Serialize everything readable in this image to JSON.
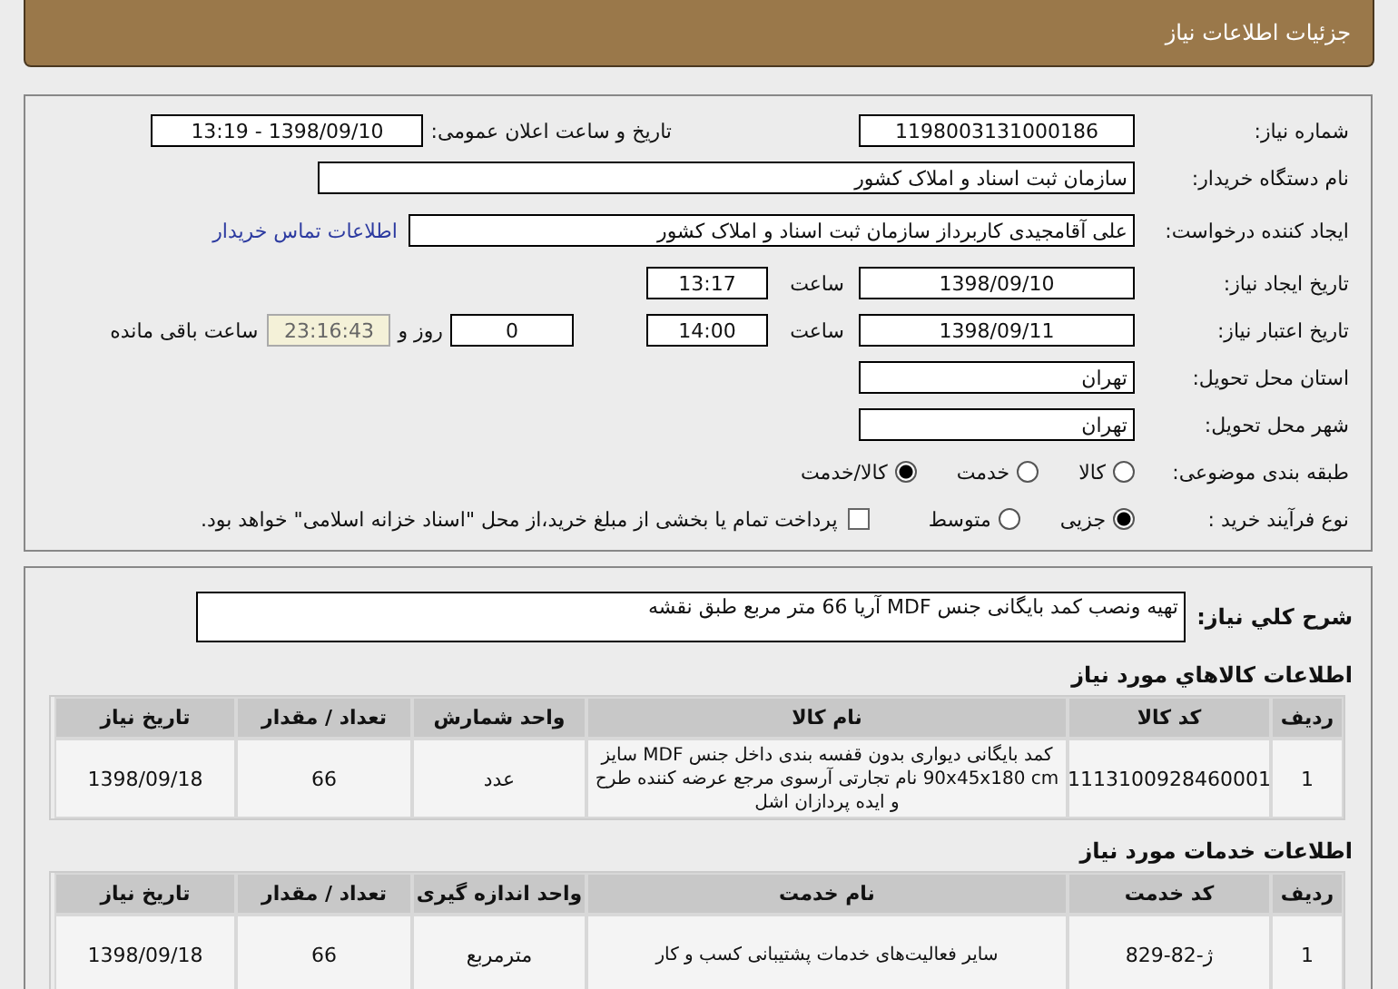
{
  "header": {
    "title": "جزئیات اطلاعات نیاز"
  },
  "form": {
    "need_number": {
      "label": "شماره نیاز:",
      "value": "1198003131000186"
    },
    "announce": {
      "label": "تاریخ و ساعت اعلان عمومی:",
      "value": "1398/09/10 - 13:19"
    },
    "buyer": {
      "label": "نام دستگاه خریدار:",
      "value": "سازمان ثبت اسناد و املاک کشور"
    },
    "creator": {
      "label": "ایجاد کننده درخواست:",
      "value": "علی آقامجیدی کاربرداز سازمان ثبت اسناد و املاک کشور",
      "link": "اطلاعات تماس خریدار"
    },
    "created": {
      "label": "تاریخ ایجاد نیاز:",
      "date": "1398/09/10",
      "time_label": "ساعت",
      "time": "13:17"
    },
    "valid": {
      "label": "تاریخ اعتبار نیاز:",
      "date": "1398/09/11",
      "time_label": "ساعت",
      "time": "14:00",
      "days": "0",
      "days_label": "روز و",
      "remaining": "23:16:43",
      "remaining_label": "ساعت باقی مانده"
    },
    "province": {
      "label": "استان محل تحویل:",
      "value": "تهران"
    },
    "city": {
      "label": "شهر محل تحویل:",
      "value": "تهران"
    },
    "category": {
      "label": "طبقه بندی موضوعی:",
      "options": [
        {
          "label": "کالا",
          "selected": false
        },
        {
          "label": "خدمت",
          "selected": false
        },
        {
          "label": "کالا/خدمت",
          "selected": true
        }
      ]
    },
    "process": {
      "label": "نوع فرآیند خرید :",
      "options": [
        {
          "label": "جزیی",
          "selected": true
        },
        {
          "label": "متوسط",
          "selected": false
        }
      ],
      "treasury": {
        "label": "پرداخت تمام یا بخشی از مبلغ خرید،از محل \"اسناد خزانه اسلامی\" خواهد بود.",
        "checked": false
      }
    }
  },
  "description": {
    "label": "شرح کلي نياز:",
    "value": "تهیه ونصب کمد بایگانی  جنس MDF آریا 66 متر مربع طبق نقشه"
  },
  "goods": {
    "title": "اطلاعات کالاهاي مورد نياز",
    "columns": [
      "ردیف",
      "کد کالا",
      "نام کالا",
      "واحد شمارش",
      "تعداد / مقدار",
      "تاریخ نیاز"
    ],
    "rows": [
      [
        "1",
        "1113100928460001",
        "کمد بایگانی دیواری بدون قفسه بندی داخل جنس MDF سایز 90x45x180 cm نام تجارتی آرسوی مرجع عرضه کننده طرح و ایده پردازان اشل",
        "عدد",
        "66",
        "1398/09/18"
      ]
    ]
  },
  "services": {
    "title": "اطلاعات خدمات مورد نياز",
    "columns": [
      "ردیف",
      "کد خدمت",
      "نام خدمت",
      "واحد اندازه گیری",
      "تعداد / مقدار",
      "تاریخ نیاز"
    ],
    "rows": [
      [
        "1",
        "ژ-82-829",
        "سایر فعالیت‌های خدمات پشتیبانی کسب و کار",
        "مترمربع",
        "66",
        "1398/09/18"
      ]
    ]
  }
}
